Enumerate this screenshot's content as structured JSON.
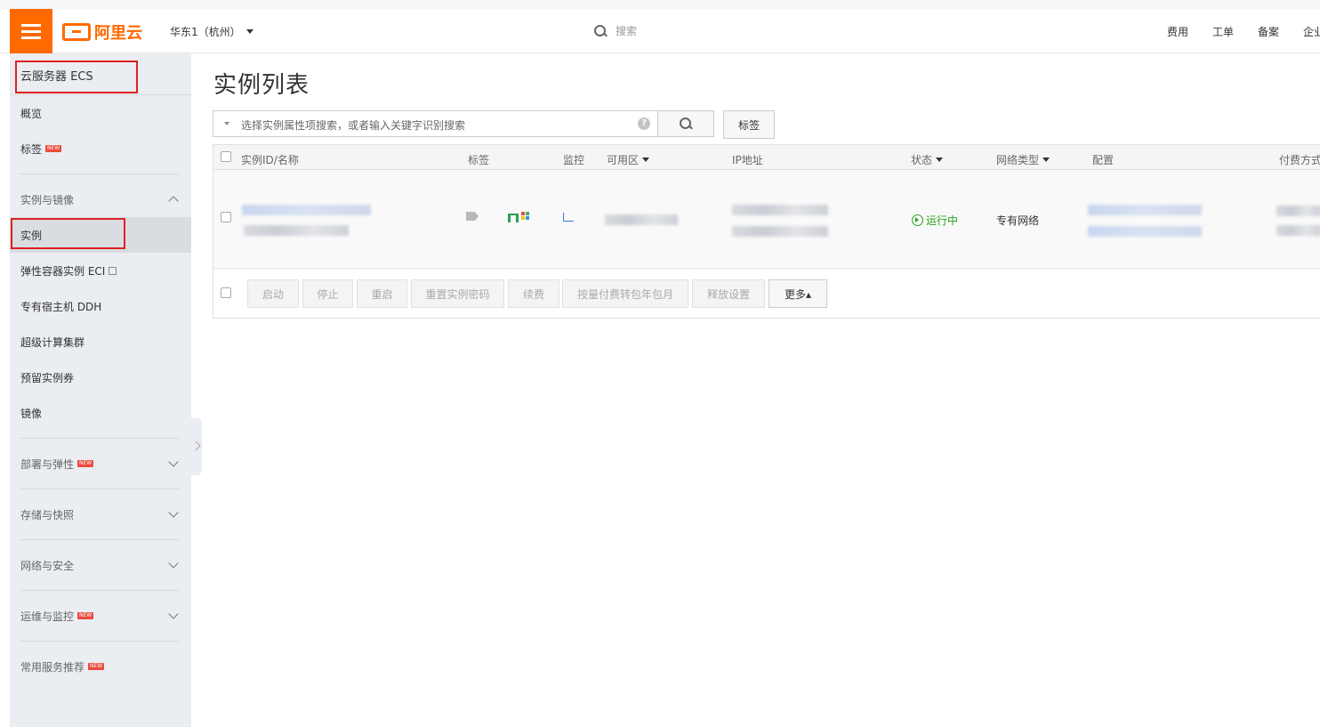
{
  "topbar": {
    "logo_text": "阿里云",
    "region": "华东1（杭州）",
    "search_placeholder": "搜索",
    "nav": [
      "费用",
      "工单",
      "备案",
      "企业"
    ],
    "accent": "#ff6a00"
  },
  "sidebar": {
    "title": "云服务器 ECS",
    "items_top": [
      "概览",
      "标签"
    ],
    "group_instances": "实例与镜像",
    "items_instances": [
      "实例",
      "弹性容器实例 ECI",
      "专有宿主机 DDH",
      "超级计算集群",
      "预留实例券",
      "镜像"
    ],
    "groups": [
      "部署与弹性",
      "存储与快照",
      "网络与安全",
      "运维与监控",
      "常用服务推荐"
    ],
    "new_badge": "NEW"
  },
  "main": {
    "title": "实例列表",
    "filter_placeholder": "选择实例属性项搜索，或者输入关键字识别搜索",
    "help_icon": "?",
    "tag_button": "标签",
    "columns": [
      "实例ID/名称",
      "标签",
      "监控",
      "可用区",
      "IP地址",
      "状态",
      "网络类型",
      "配置",
      "付费方式"
    ],
    "row": {
      "status": "运行中",
      "network": "专有网络"
    },
    "footer_buttons": [
      "启动",
      "停止",
      "重启",
      "重置实例密码",
      "续费",
      "按量付费转包年包月",
      "释放设置",
      "更多▴"
    ]
  }
}
